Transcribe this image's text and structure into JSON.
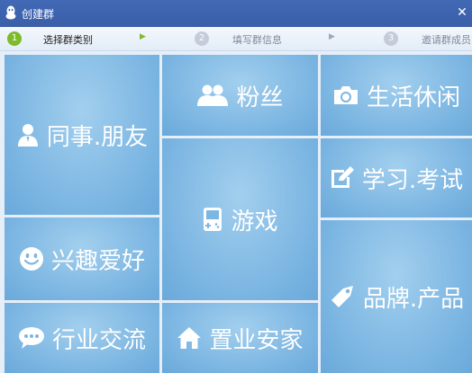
{
  "window": {
    "title": "创建群",
    "close_glyph": "✕"
  },
  "steps": [
    {
      "num": "1",
      "label": "选择群类别",
      "state": "active"
    },
    {
      "num": "2",
      "label": "填写群信息",
      "state": "inactive"
    },
    {
      "num": "3",
      "label": "邀请群成员",
      "state": "inactive"
    }
  ],
  "step_arrow_glyph": "▶",
  "categories": [
    {
      "id": "colleagues",
      "label": "同事.朋友",
      "icon": "person-icon"
    },
    {
      "id": "fans",
      "label": "粉丝",
      "icon": "people-icon"
    },
    {
      "id": "life",
      "label": "生活休闲",
      "icon": "camera-icon"
    },
    {
      "id": "games",
      "label": "游戏",
      "icon": "gamepad-icon"
    },
    {
      "id": "study",
      "label": "学习.考试",
      "icon": "edit-icon"
    },
    {
      "id": "hobbies",
      "label": "兴趣爱好",
      "icon": "smiley-icon"
    },
    {
      "id": "brands",
      "label": "品牌.产品",
      "icon": "tag-icon"
    },
    {
      "id": "industry",
      "label": "行业交流",
      "icon": "chat-bubble-icon"
    },
    {
      "id": "realestate",
      "label": "置业安家",
      "icon": "house-icon"
    }
  ],
  "colors": {
    "titlebar": "#3d62ab",
    "tile": "#7cb6e2",
    "step_active": "#7dbb2a"
  }
}
